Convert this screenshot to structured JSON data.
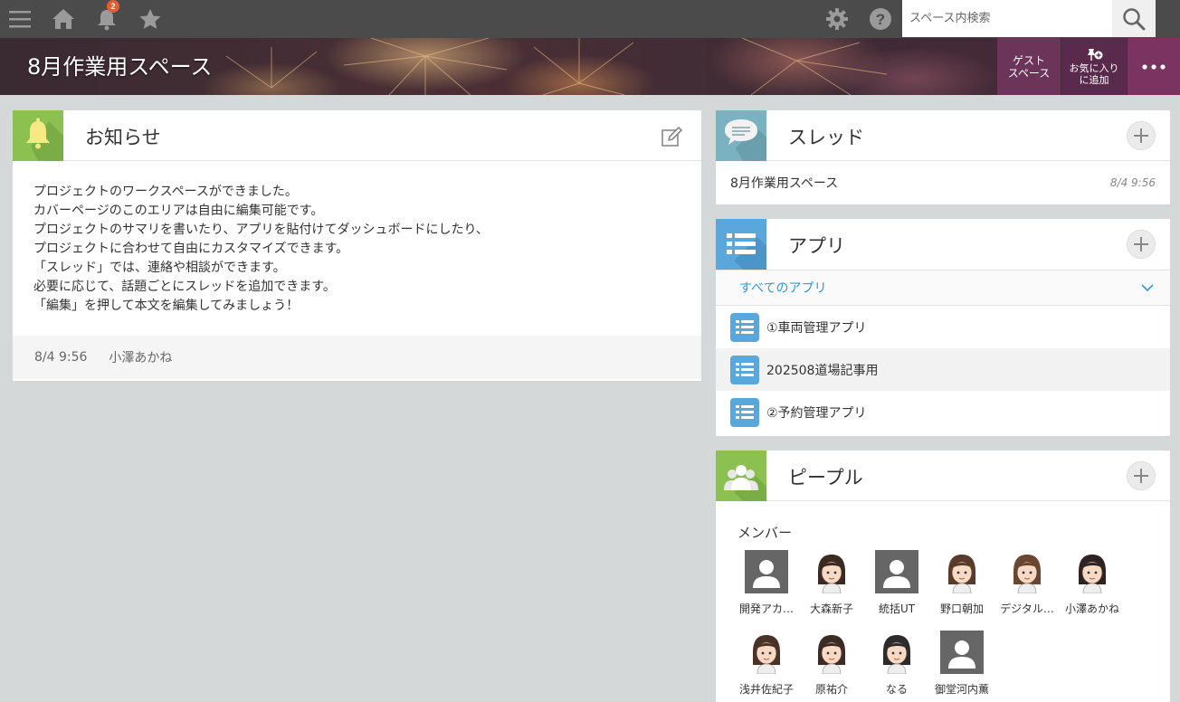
{
  "topbar": {
    "notification_count": "2",
    "search_placeholder": "スペース内検索"
  },
  "cover": {
    "title": "8月作業用スペース",
    "guest_space_line1": "ゲスト",
    "guest_space_line2": "スペース",
    "favorite_line1": "お気に入り",
    "favorite_line2": "に追加"
  },
  "notice": {
    "title": "お知らせ",
    "lines": [
      "プロジェクトのワークスペースができました。",
      "カバーページのこのエリアは自由に編集可能です。",
      "プロジェクトのサマリを書いたり、アプリを貼付けてダッシュボードにしたり、",
      "プロジェクトに合わせて自由にカスタマイズできます。",
      "「スレッド」では、連絡や相談ができます。",
      "必要に応じて、話題ごとにスレッドを追加できます。",
      "「編集」を押して本文を編集してみましょう！"
    ],
    "footer_time": "8/4 9:56",
    "footer_author": "小澤あかね"
  },
  "threads": {
    "title": "スレッド",
    "items": [
      {
        "name": "8月作業用スペース",
        "time": "8/4 9:56"
      }
    ]
  },
  "apps": {
    "title": "アプリ",
    "filter": "すべてのアプリ",
    "items": [
      {
        "name": "①車両管理アプリ"
      },
      {
        "name": "202508道場記事用"
      },
      {
        "name": "②予約管理アプリ"
      }
    ]
  },
  "people": {
    "title": "ピープル",
    "members_label": "メンバー",
    "members": [
      {
        "name": "開発アカ…",
        "avatar": "silhouette"
      },
      {
        "name": "大森新子",
        "avatar": "illustration"
      },
      {
        "name": "統括UT",
        "avatar": "silhouette"
      },
      {
        "name": "野口朝加",
        "avatar": "illustration"
      },
      {
        "name": "デジタル…",
        "avatar": "illustration"
      },
      {
        "name": "小澤あかね",
        "avatar": "illustration"
      },
      {
        "name": "浅井佐紀子",
        "avatar": "illustration"
      },
      {
        "name": "原祐介",
        "avatar": "illustration"
      },
      {
        "name": "なる",
        "avatar": "illustration"
      },
      {
        "name": "御堂河内薫",
        "avatar": "silhouette"
      }
    ]
  },
  "colors": {
    "topbar": "#4b4b4b",
    "notice_icon_bg": "#8cc152",
    "thread_icon_bg": "#7ab2c1",
    "app_icon_bg": "#5aa7dc",
    "people_icon_bg": "#8cc152",
    "guest_button_bg": "#6b3458",
    "favorite_button_bg": "#5a2a4c",
    "more_button_bg": "#7a3462",
    "link": "#3498db"
  }
}
